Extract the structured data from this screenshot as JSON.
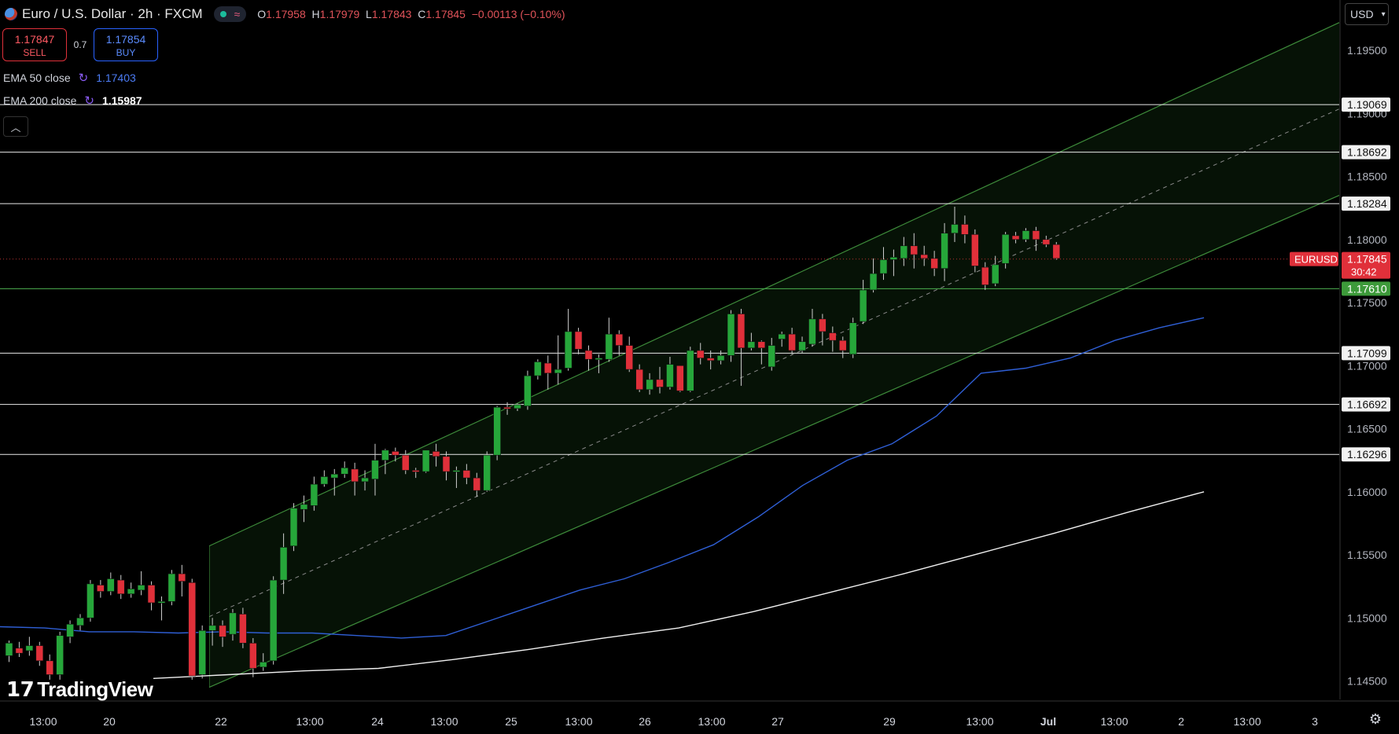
{
  "header": {
    "symbol_title": "Euro / U.S. Dollar · 2h · FXCM",
    "ohlc": {
      "o_label": "O",
      "o": "1.17958",
      "h_label": "H",
      "h": "1.17979",
      "l_label": "L",
      "l": "1.17843",
      "c_label": "C",
      "c": "1.17845",
      "change": "−0.00113 (−0.10%)"
    }
  },
  "trade": {
    "sell_price": "1.17847",
    "sell_label": "SELL",
    "spread": "0.7",
    "buy_price": "1.17854",
    "buy_label": "BUY"
  },
  "indicators": [
    {
      "label": "EMA 50 close",
      "value": "1.17403"
    },
    {
      "label": "EMA 200 close",
      "value": "1.15987"
    }
  ],
  "currency": "USD",
  "logo_text": "TradingView",
  "icons": {
    "flag": "eu-us-flag-icon",
    "market_status": "market-open-dot-icon",
    "data_wave": "wave-icon",
    "indicator_loading": "loading-icon",
    "collapse": "chevron-up-icon",
    "dropdown": "chevron-down-icon",
    "settings": "gear-icon"
  },
  "colors": {
    "up": "#26a63a",
    "down": "#e0303a",
    "ema50": "#2f5fd6",
    "ema200": "#f0f0f0",
    "channel": "#2a6a28",
    "level": "#e8e8e8",
    "support": "#4caf50",
    "price_tag": "#e0303a"
  },
  "chart_data": {
    "type": "candlestick",
    "y_axis": {
      "ticks": [
        "1.19500",
        "1.19000",
        "1.18500",
        "1.18000",
        "1.17500",
        "1.17000",
        "1.16500",
        "1.16000",
        "1.15500",
        "1.15000",
        "1.14500"
      ]
    },
    "x_axis": {
      "ticks": [
        "13:00",
        "20",
        "22",
        "13:00",
        "24",
        "13:00",
        "25",
        "13:00",
        "26",
        "13:00",
        "27",
        "29",
        "13:00",
        "Jul",
        "13:00",
        "2",
        "13:00",
        "3"
      ]
    },
    "horizontal_levels": [
      {
        "label": "1.19069",
        "value": 1.19069
      },
      {
        "label": "1.18692",
        "value": 1.18692
      },
      {
        "label": "1.18284",
        "value": 1.18284
      },
      {
        "label": "1.17610",
        "value": 1.1761
      },
      {
        "label": "1.17099",
        "value": 1.17099
      },
      {
        "label": "1.16692",
        "value": 1.16692
      },
      {
        "label": "1.16296",
        "value": 1.16296
      }
    ],
    "current_price": {
      "symbol": "EURUSD",
      "label": "1.17845",
      "value": 1.17845,
      "countdown": "30:42"
    },
    "candles": [
      [
        1.147,
        1.148,
        1.1465,
        1.1482
      ],
      [
        1.1476,
        1.1472,
        1.1469,
        1.1481
      ],
      [
        1.1474,
        1.1478,
        1.147,
        1.1485
      ],
      [
        1.1478,
        1.1466,
        1.1462,
        1.1481
      ],
      [
        1.1466,
        1.1455,
        1.1451,
        1.1471
      ],
      [
        1.1455,
        1.1486,
        1.1451,
        1.1489
      ],
      [
        1.1485,
        1.1495,
        1.148,
        1.1498
      ],
      [
        1.1494,
        1.15,
        1.149,
        1.1503
      ],
      [
        1.15,
        1.1527,
        1.1497,
        1.153
      ],
      [
        1.1526,
        1.1521,
        1.1516,
        1.153
      ],
      [
        1.1521,
        1.1531,
        1.1518,
        1.1536
      ],
      [
        1.153,
        1.1519,
        1.1515,
        1.1534
      ],
      [
        1.1519,
        1.1523,
        1.1516,
        1.1528
      ],
      [
        1.1522,
        1.1526,
        1.1518,
        1.1537
      ],
      [
        1.1526,
        1.1512,
        1.1506,
        1.1529
      ],
      [
        1.1512,
        1.1513,
        1.1498,
        1.1517
      ],
      [
        1.1513,
        1.1535,
        1.151,
        1.1538
      ],
      [
        1.1535,
        1.1529,
        1.1517,
        1.1542
      ],
      [
        1.1528,
        1.1454,
        1.1451,
        1.1531
      ],
      [
        1.1455,
        1.149,
        1.1452,
        1.1494
      ],
      [
        1.149,
        1.1494,
        1.1478,
        1.15
      ],
      [
        1.1494,
        1.1485,
        1.1477,
        1.1498
      ],
      [
        1.1487,
        1.1504,
        1.1482,
        1.1507
      ],
      [
        1.1503,
        1.148,
        1.1476,
        1.1508
      ],
      [
        1.148,
        1.146,
        1.1453,
        1.1484
      ],
      [
        1.1461,
        1.1465,
        1.1458,
        1.1472
      ],
      [
        1.1466,
        1.153,
        1.1463,
        1.1533
      ],
      [
        1.153,
        1.1556,
        1.1519,
        1.1567
      ],
      [
        1.1557,
        1.1587,
        1.1553,
        1.1591
      ],
      [
        1.1586,
        1.159,
        1.1576,
        1.1597
      ],
      [
        1.1589,
        1.1606,
        1.1585,
        1.1612
      ],
      [
        1.1606,
        1.1612,
        1.1604,
        1.1617
      ],
      [
        1.1611,
        1.1614,
        1.1597,
        1.1618
      ],
      [
        1.1614,
        1.1619,
        1.1611,
        1.1624
      ],
      [
        1.1618,
        1.1608,
        1.1597,
        1.1623
      ],
      [
        1.1608,
        1.1611,
        1.1601,
        1.1617
      ],
      [
        1.161,
        1.1625,
        1.1597,
        1.1638
      ],
      [
        1.1625,
        1.1633,
        1.1614,
        1.1634
      ],
      [
        1.1632,
        1.1629,
        1.1624,
        1.1635
      ],
      [
        1.1629,
        1.1617,
        1.1614,
        1.1633
      ],
      [
        1.1617,
        1.1616,
        1.1611,
        1.1619
      ],
      [
        1.1616,
        1.1633,
        1.1615,
        1.1633
      ],
      [
        1.1632,
        1.1628,
        1.162,
        1.1638
      ],
      [
        1.1628,
        1.1616,
        1.1609,
        1.1632
      ],
      [
        1.1616,
        1.1617,
        1.1603,
        1.162
      ],
      [
        1.1617,
        1.1611,
        1.1606,
        1.1622
      ],
      [
        1.1611,
        1.1601,
        1.1596,
        1.1615
      ],
      [
        1.1601,
        1.1629,
        1.16,
        1.1632
      ],
      [
        1.1629,
        1.1667,
        1.1625,
        1.1668
      ],
      [
        1.1667,
        1.1666,
        1.1661,
        1.1671
      ],
      [
        1.1666,
        1.1669,
        1.1664,
        1.167
      ],
      [
        1.1668,
        1.1692,
        1.1665,
        1.1696
      ],
      [
        1.1692,
        1.1703,
        1.1689,
        1.1705
      ],
      [
        1.1702,
        1.1694,
        1.1681,
        1.1708
      ],
      [
        1.1694,
        1.1697,
        1.1685,
        1.1724
      ],
      [
        1.1698,
        1.1727,
        1.1696,
        1.1745
      ],
      [
        1.1727,
        1.1713,
        1.1709,
        1.173
      ],
      [
        1.1712,
        1.1705,
        1.1696,
        1.1716
      ],
      [
        1.1705,
        1.1706,
        1.1694,
        1.1709
      ],
      [
        1.1705,
        1.1725,
        1.1703,
        1.1738
      ],
      [
        1.1725,
        1.1716,
        1.1708,
        1.1728
      ],
      [
        1.1716,
        1.1697,
        1.1695,
        1.1723
      ],
      [
        1.1697,
        1.1681,
        1.1679,
        1.1701
      ],
      [
        1.1681,
        1.1689,
        1.1677,
        1.1694
      ],
      [
        1.1689,
        1.1683,
        1.1678,
        1.1699
      ],
      [
        1.1683,
        1.1701,
        1.1681,
        1.1707
      ],
      [
        1.17,
        1.168,
        1.1679,
        1.17
      ],
      [
        1.168,
        1.1712,
        1.1679,
        1.1715
      ],
      [
        1.1712,
        1.1706,
        1.1701,
        1.1718
      ],
      [
        1.1706,
        1.1704,
        1.1697,
        1.1712
      ],
      [
        1.1704,
        1.1708,
        1.1701,
        1.1712
      ],
      [
        1.1708,
        1.1741,
        1.1703,
        1.1744
      ],
      [
        1.1741,
        1.1714,
        1.1684,
        1.1745
      ],
      [
        1.1714,
        1.1719,
        1.1712,
        1.1726
      ],
      [
        1.1719,
        1.1714,
        1.1701,
        1.172
      ],
      [
        1.1699,
        1.1716,
        1.1696,
        1.1722
      ],
      [
        1.1721,
        1.1725,
        1.1715,
        1.1727
      ],
      [
        1.1725,
        1.1712,
        1.1709,
        1.173
      ],
      [
        1.1712,
        1.1719,
        1.171,
        1.1723
      ],
      [
        1.1717,
        1.1737,
        1.1715,
        1.1745
      ],
      [
        1.1737,
        1.1727,
        1.1716,
        1.1741
      ],
      [
        1.1726,
        1.172,
        1.1711,
        1.1731
      ],
      [
        1.172,
        1.1712,
        1.1706,
        1.1723
      ],
      [
        1.1709,
        1.1734,
        1.1706,
        1.1738
      ],
      [
        1.1735,
        1.176,
        1.1733,
        1.1768
      ],
      [
        1.176,
        1.1773,
        1.1758,
        1.1785
      ],
      [
        1.1773,
        1.1784,
        1.1768,
        1.1794
      ],
      [
        1.1784,
        1.1786,
        1.1771,
        1.1792
      ],
      [
        1.1785,
        1.1795,
        1.1779,
        1.1802
      ],
      [
        1.1795,
        1.1788,
        1.1777,
        1.1805
      ],
      [
        1.1788,
        1.1785,
        1.1779,
        1.1795
      ],
      [
        1.1785,
        1.1777,
        1.1771,
        1.1791
      ],
      [
        1.1777,
        1.1805,
        1.1767,
        1.1813
      ],
      [
        1.1805,
        1.1812,
        1.1798,
        1.1826
      ],
      [
        1.1812,
        1.1804,
        1.1797,
        1.1819
      ],
      [
        1.1804,
        1.1779,
        1.1774,
        1.1808
      ],
      [
        1.1778,
        1.1764,
        1.176,
        1.1782
      ],
      [
        1.1765,
        1.178,
        1.1763,
        1.1787
      ],
      [
        1.1781,
        1.1804,
        1.1777,
        1.1806
      ],
      [
        1.1803,
        1.18,
        1.1797,
        1.1806
      ],
      [
        1.18,
        1.1807,
        1.1798,
        1.1809
      ],
      [
        1.1807,
        1.18,
        1.1791,
        1.181
      ],
      [
        1.18,
        1.1796,
        1.1794,
        1.1803
      ],
      [
        1.1796,
        1.1785,
        1.1784,
        1.1798
      ]
    ],
    "ema50": [
      1.1493,
      1.1492,
      1.1489,
      1.1489,
      1.1488,
      1.1489,
      1.1488,
      1.1488,
      1.1486,
      1.1484,
      1.1486,
      1.1498,
      1.151,
      1.1522,
      1.1531,
      1.1544,
      1.1558,
      1.158,
      1.1605,
      1.1625,
      1.1638,
      1.166,
      1.1694,
      1.1698,
      1.1706,
      1.172,
      1.173,
      1.1738
    ],
    "ema200": [
      1.1452,
      1.1455,
      1.1458,
      1.146,
      1.1467,
      1.1475,
      1.1484,
      1.1492,
      1.1505,
      1.152,
      1.1535,
      1.1551,
      1.1567,
      1.1584,
      1.16
    ],
    "channel": {
      "lower_start": 1.1445,
      "lower_end": 1.1835,
      "upper_start": 1.1557,
      "upper_end": 1.1972
    }
  }
}
